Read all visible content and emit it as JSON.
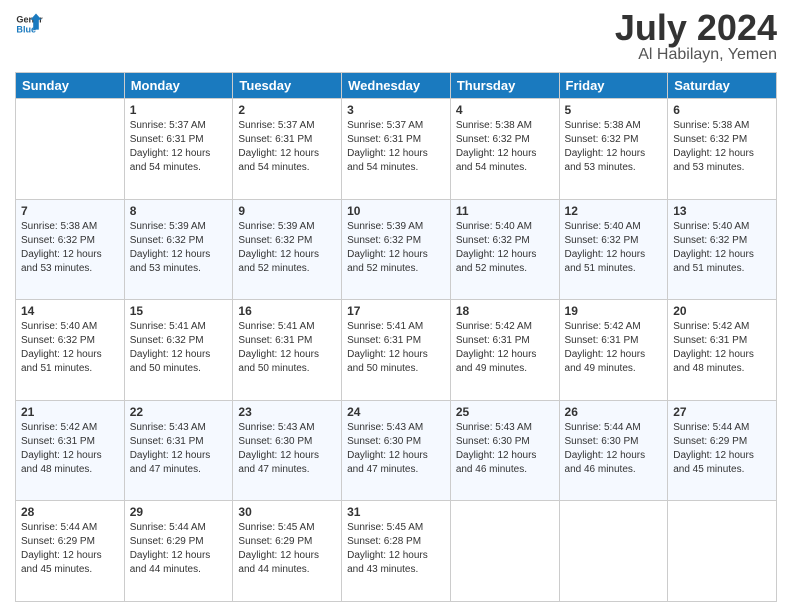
{
  "header": {
    "logo_line1": "General",
    "logo_line2": "Blue",
    "title": "July 2024",
    "subtitle": "Al Habilayn, Yemen"
  },
  "days_of_week": [
    "Sunday",
    "Monday",
    "Tuesday",
    "Wednesday",
    "Thursday",
    "Friday",
    "Saturday"
  ],
  "weeks": [
    [
      {
        "day": "",
        "info": ""
      },
      {
        "day": "1",
        "info": "Sunrise: 5:37 AM\nSunset: 6:31 PM\nDaylight: 12 hours\nand 54 minutes."
      },
      {
        "day": "2",
        "info": "Sunrise: 5:37 AM\nSunset: 6:31 PM\nDaylight: 12 hours\nand 54 minutes."
      },
      {
        "day": "3",
        "info": "Sunrise: 5:37 AM\nSunset: 6:31 PM\nDaylight: 12 hours\nand 54 minutes."
      },
      {
        "day": "4",
        "info": "Sunrise: 5:38 AM\nSunset: 6:32 PM\nDaylight: 12 hours\nand 54 minutes."
      },
      {
        "day": "5",
        "info": "Sunrise: 5:38 AM\nSunset: 6:32 PM\nDaylight: 12 hours\nand 53 minutes."
      },
      {
        "day": "6",
        "info": "Sunrise: 5:38 AM\nSunset: 6:32 PM\nDaylight: 12 hours\nand 53 minutes."
      }
    ],
    [
      {
        "day": "7",
        "info": "Sunrise: 5:38 AM\nSunset: 6:32 PM\nDaylight: 12 hours\nand 53 minutes."
      },
      {
        "day": "8",
        "info": "Sunrise: 5:39 AM\nSunset: 6:32 PM\nDaylight: 12 hours\nand 53 minutes."
      },
      {
        "day": "9",
        "info": "Sunrise: 5:39 AM\nSunset: 6:32 PM\nDaylight: 12 hours\nand 52 minutes."
      },
      {
        "day": "10",
        "info": "Sunrise: 5:39 AM\nSunset: 6:32 PM\nDaylight: 12 hours\nand 52 minutes."
      },
      {
        "day": "11",
        "info": "Sunrise: 5:40 AM\nSunset: 6:32 PM\nDaylight: 12 hours\nand 52 minutes."
      },
      {
        "day": "12",
        "info": "Sunrise: 5:40 AM\nSunset: 6:32 PM\nDaylight: 12 hours\nand 51 minutes."
      },
      {
        "day": "13",
        "info": "Sunrise: 5:40 AM\nSunset: 6:32 PM\nDaylight: 12 hours\nand 51 minutes."
      }
    ],
    [
      {
        "day": "14",
        "info": "Sunrise: 5:40 AM\nSunset: 6:32 PM\nDaylight: 12 hours\nand 51 minutes."
      },
      {
        "day": "15",
        "info": "Sunrise: 5:41 AM\nSunset: 6:32 PM\nDaylight: 12 hours\nand 50 minutes."
      },
      {
        "day": "16",
        "info": "Sunrise: 5:41 AM\nSunset: 6:31 PM\nDaylight: 12 hours\nand 50 minutes."
      },
      {
        "day": "17",
        "info": "Sunrise: 5:41 AM\nSunset: 6:31 PM\nDaylight: 12 hours\nand 50 minutes."
      },
      {
        "day": "18",
        "info": "Sunrise: 5:42 AM\nSunset: 6:31 PM\nDaylight: 12 hours\nand 49 minutes."
      },
      {
        "day": "19",
        "info": "Sunrise: 5:42 AM\nSunset: 6:31 PM\nDaylight: 12 hours\nand 49 minutes."
      },
      {
        "day": "20",
        "info": "Sunrise: 5:42 AM\nSunset: 6:31 PM\nDaylight: 12 hours\nand 48 minutes."
      }
    ],
    [
      {
        "day": "21",
        "info": "Sunrise: 5:42 AM\nSunset: 6:31 PM\nDaylight: 12 hours\nand 48 minutes."
      },
      {
        "day": "22",
        "info": "Sunrise: 5:43 AM\nSunset: 6:31 PM\nDaylight: 12 hours\nand 47 minutes."
      },
      {
        "day": "23",
        "info": "Sunrise: 5:43 AM\nSunset: 6:30 PM\nDaylight: 12 hours\nand 47 minutes."
      },
      {
        "day": "24",
        "info": "Sunrise: 5:43 AM\nSunset: 6:30 PM\nDaylight: 12 hours\nand 47 minutes."
      },
      {
        "day": "25",
        "info": "Sunrise: 5:43 AM\nSunset: 6:30 PM\nDaylight: 12 hours\nand 46 minutes."
      },
      {
        "day": "26",
        "info": "Sunrise: 5:44 AM\nSunset: 6:30 PM\nDaylight: 12 hours\nand 46 minutes."
      },
      {
        "day": "27",
        "info": "Sunrise: 5:44 AM\nSunset: 6:29 PM\nDaylight: 12 hours\nand 45 minutes."
      }
    ],
    [
      {
        "day": "28",
        "info": "Sunrise: 5:44 AM\nSunset: 6:29 PM\nDaylight: 12 hours\nand 45 minutes."
      },
      {
        "day": "29",
        "info": "Sunrise: 5:44 AM\nSunset: 6:29 PM\nDaylight: 12 hours\nand 44 minutes."
      },
      {
        "day": "30",
        "info": "Sunrise: 5:45 AM\nSunset: 6:29 PM\nDaylight: 12 hours\nand 44 minutes."
      },
      {
        "day": "31",
        "info": "Sunrise: 5:45 AM\nSunset: 6:28 PM\nDaylight: 12 hours\nand 43 minutes."
      },
      {
        "day": "",
        "info": ""
      },
      {
        "day": "",
        "info": ""
      },
      {
        "day": "",
        "info": ""
      }
    ]
  ]
}
